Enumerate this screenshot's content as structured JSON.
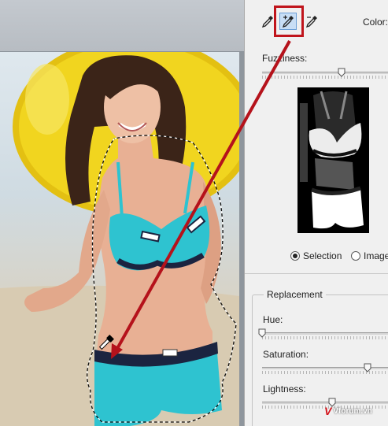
{
  "dialog": {
    "color_label": "Color:",
    "fuzziness_label": "Fuzziness:",
    "fuzziness_fraction": 0.63,
    "eyedroppers": [
      {
        "icon": "eyedropper-icon",
        "selected": false
      },
      {
        "icon": "eyedropper-plus-icon",
        "selected": true
      },
      {
        "icon": "eyedropper-minus-icon",
        "selected": false
      }
    ],
    "preview_modes": {
      "selection_label": "Selection",
      "image_label": "Image",
      "selected": "selection"
    }
  },
  "replacement": {
    "title": "Replacement",
    "hue_label": "Hue:",
    "hue_fraction": 0.0,
    "saturation_label": "Saturation:",
    "saturation_fraction": 0.83,
    "lightness_label": "Lightness:",
    "lightness_fraction": 0.55
  },
  "watermark": {
    "text": "Vforum.vn"
  },
  "colors": {
    "annotation_red": "#c0151c",
    "selected_tool_bg": "#c8def5",
    "swimsuit_cyan": "#2ec3d0",
    "float_yellow": "#f1d51f"
  }
}
